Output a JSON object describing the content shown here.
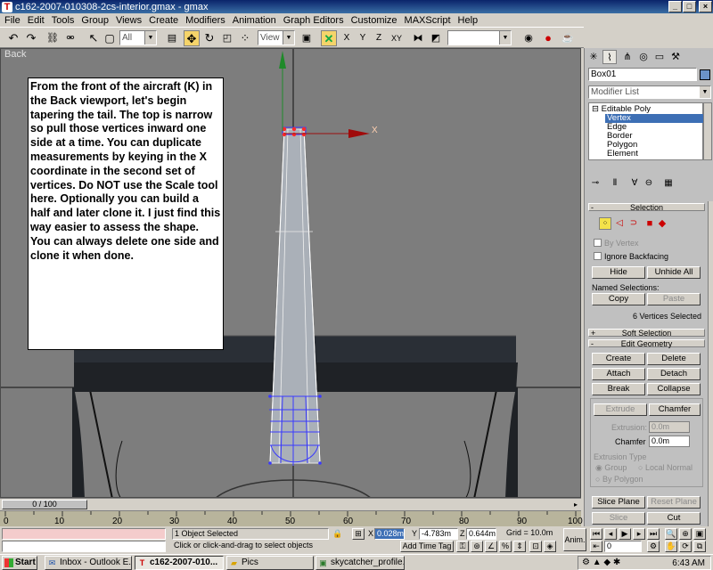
{
  "window": {
    "title": "c162-2007-010308-2cs-interior.gmax - gmax",
    "app_icon": "gmax-icon",
    "controls": [
      "_",
      "□",
      "×"
    ]
  },
  "menu": [
    "File",
    "Edit",
    "Tools",
    "Group",
    "Views",
    "Create",
    "Modifiers",
    "Animation",
    "Graph Editors",
    "Customize",
    "MAXScript",
    "Help"
  ],
  "toolbar": {
    "selection_filter": "All",
    "ref_coord": "View",
    "named_selection": "",
    "axis_x": "X",
    "axis_y": "Y",
    "axis_z": "Z",
    "axis_xy": "XY"
  },
  "viewport": {
    "label": "Back",
    "gizmo_axis": "X",
    "instructions": "From the front of the aircraft (K) in the Back viewport, let's begin tapering the tail.  The top is narrow so pull those vertices inward one side at a time.  You can duplicate measurements by keying in the X coordinate in the second set of vertices.  Do NOT use the Scale tool here. Optionally you can build a half and later clone it.  I just find this way easier to assess the shape.  You can always delete one side and clone it when done."
  },
  "time_slider": {
    "position": "0 / 100",
    "ticks": [
      "0",
      "10",
      "20",
      "30",
      "40",
      "50",
      "60",
      "70",
      "80",
      "90",
      "100"
    ]
  },
  "status": {
    "selection_count": "1 Object Selected",
    "prompt": "Click or click-and-drag to select objects",
    "x_label": "X",
    "x_value": "0.028m",
    "y_label": "Y",
    "y_value": "-4.783m",
    "z_label": "Z",
    "z_value": "0.644m",
    "grid": "Grid = 10.0m",
    "add_time_tag": "Add Time Tag",
    "anim_button": "Anim.",
    "frame_field": "0"
  },
  "command_panel": {
    "object_name": "Box01",
    "object_color": "#6a92c8",
    "modifier_list": "Modifier List",
    "stack": {
      "root": "Editable Poly",
      "items": [
        "Vertex",
        "Edge",
        "Border",
        "Polygon",
        "Element"
      ],
      "selected": "Vertex"
    },
    "selection": {
      "title": "Selection",
      "by_vertex": "By Vertex",
      "ignore_backfacing": "Ignore Backfacing",
      "hide": "Hide",
      "unhide_all": "Unhide All",
      "named_selections": "Named Selections:",
      "copy": "Copy",
      "paste": "Paste",
      "info": "6 Vertices Selected"
    },
    "soft_selection": {
      "title": "Soft Selection",
      "sign": "+"
    },
    "edit_geometry": {
      "title": "Edit Geometry",
      "sign": "-",
      "create": "Create",
      "delete": "Delete",
      "attach": "Attach",
      "detach": "Detach",
      "break": "Break",
      "collapse": "Collapse",
      "extrude": "Extrude",
      "chamfer": "Chamfer",
      "extrusion_label": "Extrusion:",
      "extrusion_value": "0.0m",
      "chamfer_label": "Chamfer",
      "chamfer_value": "0.0m",
      "extrusion_type": "Extrusion Type",
      "group": "Group",
      "local_normal": "Local Normal",
      "by_polygon": "By Polygon",
      "slice_plane": "Slice Plane",
      "reset_plane": "Reset Plane",
      "slice": "Slice",
      "cut": "Cut"
    }
  },
  "taskbar": {
    "start": "Start",
    "tasks": [
      {
        "label": "Inbox - Outlook E...",
        "icon": "outlook-icon"
      },
      {
        "label": "c162-2007-010...",
        "icon": "gmax-icon"
      },
      {
        "label": "Pics",
        "icon": "folder-icon"
      },
      {
        "label": "skycatcher_profile....",
        "icon": "image-icon"
      }
    ],
    "clock": "6:43 AM"
  }
}
